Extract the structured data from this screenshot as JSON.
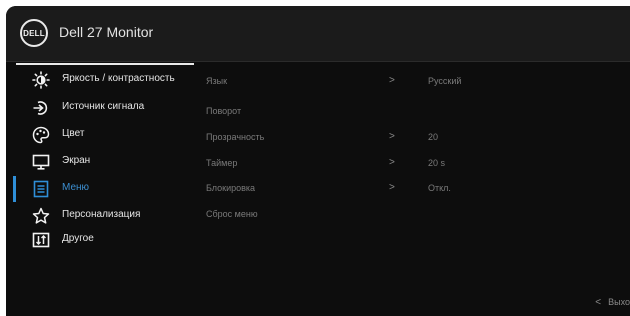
{
  "header": {
    "logo_text": "DELL",
    "title": "Dell 27 Monitor"
  },
  "menu": {
    "items": [
      {
        "label": "Яркость / контрастность",
        "icon": "brightness-icon"
      },
      {
        "label": "Источник сигнала",
        "icon": "input-source-icon"
      },
      {
        "label": "Цвет",
        "icon": "color-palette-icon"
      },
      {
        "label": "Экран",
        "icon": "display-icon"
      },
      {
        "label": "Меню",
        "icon": "menu-icon",
        "selected": true
      },
      {
        "label": "Персонализация",
        "icon": "star-icon"
      },
      {
        "label": "Другое",
        "icon": "other-icon"
      }
    ]
  },
  "options": [
    {
      "label": "Язык",
      "arrow": ">",
      "value": "Русский"
    },
    {
      "label": "Поворот",
      "arrow": "",
      "value": ""
    },
    {
      "label": "Прозрачность",
      "arrow": ">",
      "value": "20"
    },
    {
      "label": "Таймер",
      "arrow": ">",
      "value": "20 s"
    },
    {
      "label": "Блокировка",
      "arrow": ">",
      "value": "Откл."
    },
    {
      "label": "Сброс меню",
      "arrow": "",
      "value": ""
    }
  ],
  "footer": {
    "exit_label": "Выхо"
  },
  "colors": {
    "accent": "#2f8fd8",
    "background": "#0d0d0d",
    "header": "#1b1b1b"
  }
}
